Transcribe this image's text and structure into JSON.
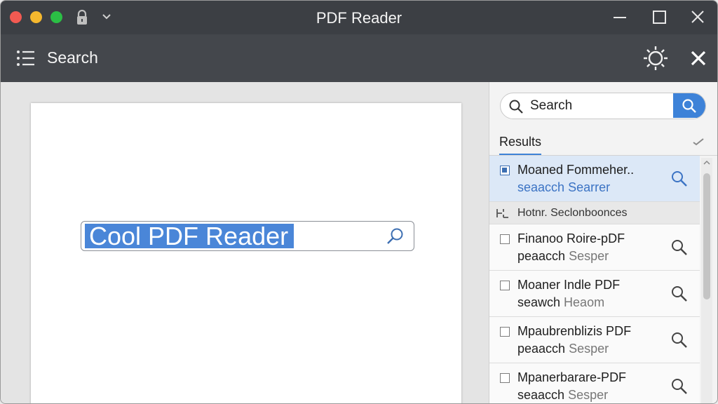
{
  "window": {
    "title": "PDF Reader"
  },
  "toolbar": {
    "title": "Search",
    "left_icon": "menu-list-icon",
    "right_icons": [
      "brightness-icon",
      "close-icon"
    ]
  },
  "document": {
    "search_text": "Cool PDF Reader",
    "highlight_color": "#4a86d8"
  },
  "sidebar": {
    "search": {
      "placeholder": "Search",
      "button_color": "#3d82d8"
    },
    "tabs": [
      {
        "label": "Results",
        "active": true
      }
    ],
    "results": [
      {
        "title": "Moaned Fommeher..",
        "sub1": "seaacch",
        "sub2": "Searrer",
        "selected": true
      },
      {
        "title": "Finanoo Roire-pDF",
        "sub1": "peaacch",
        "sub2": "Sesper",
        "selected": false
      },
      {
        "title": "Moaner Indle PDF",
        "sub1": "seawch",
        "sub2": "Heaom",
        "selected": false
      },
      {
        "title": "Mpaubrenblizis PDF",
        "sub1": "peaacch",
        "sub2": "Sesper",
        "selected": false
      },
      {
        "title": "Mpanerbarare-PDF",
        "sub1": "seaacch",
        "sub2": "Sesper",
        "selected": false
      }
    ],
    "section": {
      "label": "Hotnr. Seclonboonces"
    }
  },
  "colors": {
    "titlebar": "#3c3f44",
    "toolbar": "#44474c",
    "accent": "#3d82d8",
    "selected_row": "#dce8f7"
  }
}
